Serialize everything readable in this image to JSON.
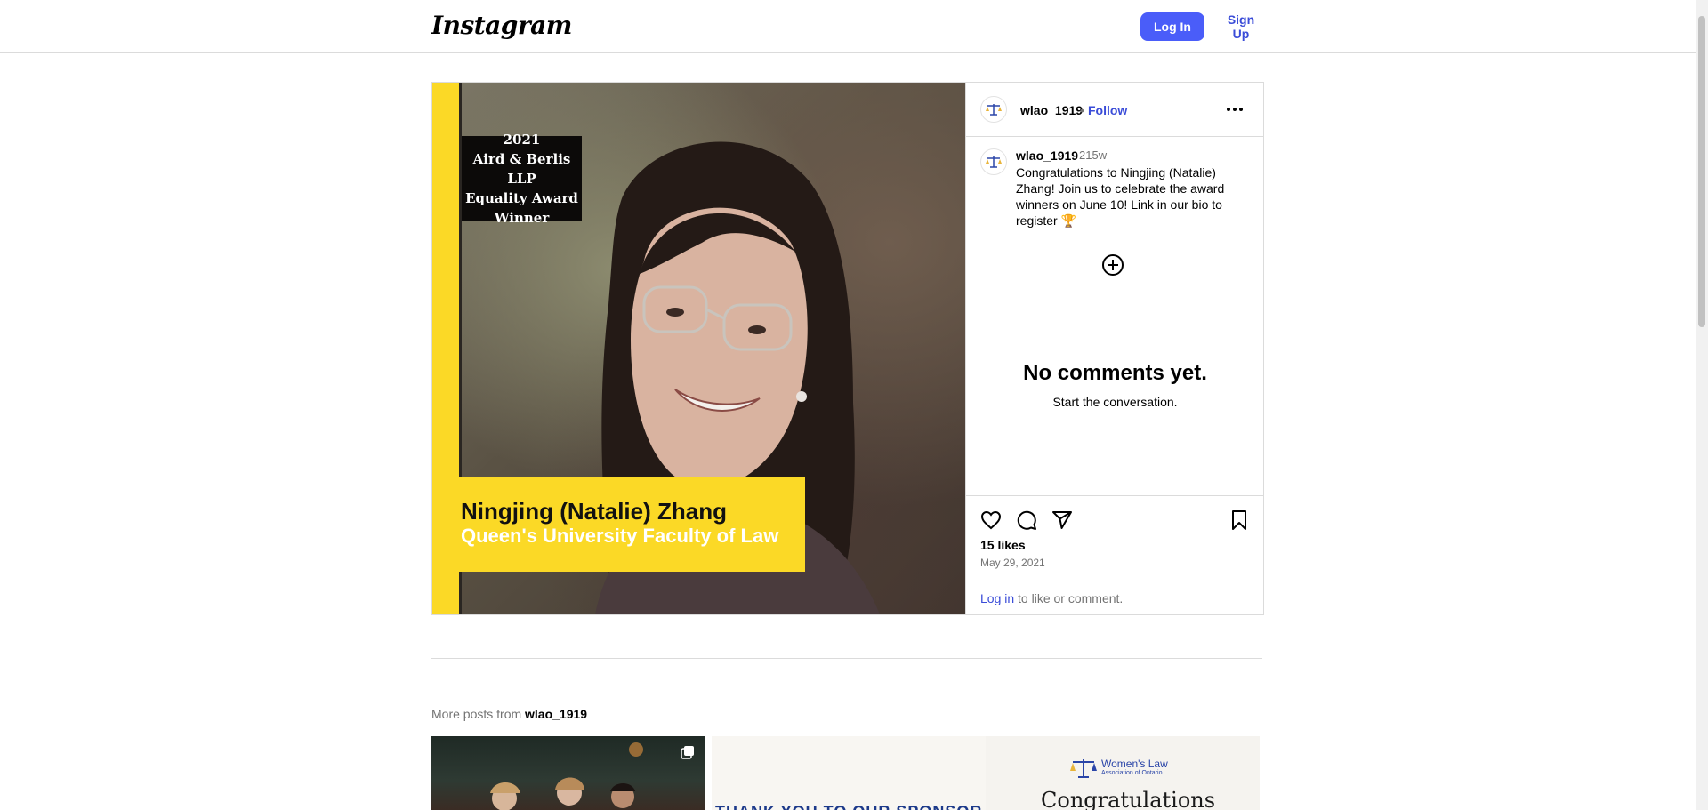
{
  "header": {
    "logo_text": "Instagram",
    "login_label": "Log In",
    "signup_label": "Sign Up"
  },
  "post": {
    "image": {
      "award_lines": [
        "2021",
        "Aird & Berlis LLP",
        "Equality Award",
        "Winner"
      ],
      "person_name": "Ningjing (Natalie) Zhang",
      "school": "Queen's University Faculty of Law"
    },
    "author": {
      "username": "wlao_1919",
      "separator": "•",
      "follow_label": "Follow"
    },
    "caption": {
      "username": "wlao_1919",
      "age": "215w",
      "text": "Congratulations to Ningjing (Natalie) Zhang! Join us to celebrate the award winners on June 10! Link in our bio to register 🏆"
    },
    "comments": {
      "empty_title": "No comments yet.",
      "empty_subtitle": "Start the conversation."
    },
    "likes": "15 likes",
    "date": "May 29, 2021",
    "login_prompt": {
      "link": "Log in",
      "rest": " to like or comment."
    }
  },
  "more_posts": {
    "label": "More posts from",
    "username": "wlao_1919",
    "thumb2_text": "THANK YOU TO OUR SPONSOR",
    "thumb3_logo_title": "Women's Law",
    "thumb3_logo_sub": "Association of Ontario",
    "thumb3_headline": "Congratulations"
  },
  "colors": {
    "accent": "#4a5df9",
    "link": "#3a4cd8",
    "brand_yellow": "#fbd926"
  },
  "icons": [
    "more-icon",
    "add-comment-icon",
    "heart-icon",
    "comment-icon",
    "share-icon",
    "bookmark-icon",
    "multi-post-icon",
    "scales-logo-icon"
  ]
}
